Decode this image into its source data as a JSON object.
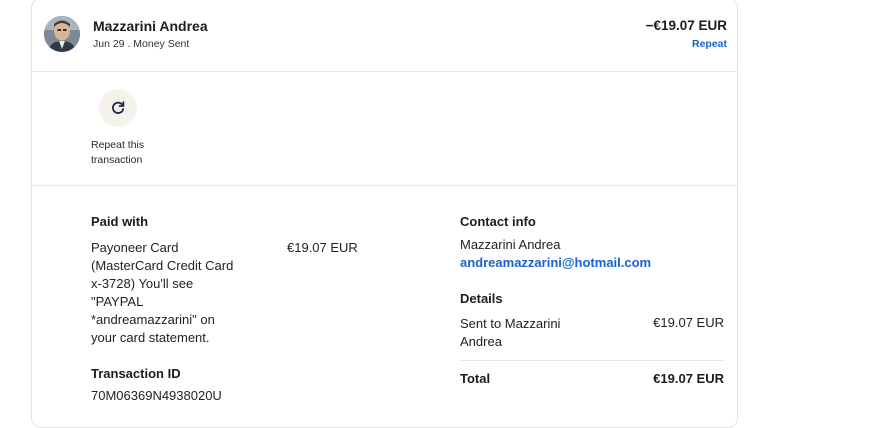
{
  "header": {
    "name": "Mazzarini Andrea",
    "subline": "Jun 29 . Money Sent",
    "amount": "−€19.07 EUR",
    "repeat_link": "Repeat"
  },
  "repeat_action": {
    "icon": "refresh-icon",
    "label": "Repeat this transaction"
  },
  "paid_with": {
    "heading": "Paid with",
    "description": "Payoneer Card (MasterCard Credit Card x-3728) You'll see \"PAYPAL *andreamazzarini\" on your card statement.",
    "amount": "€19.07 EUR"
  },
  "transaction": {
    "heading": "Transaction ID",
    "id": "70M06369N4938020U"
  },
  "contact": {
    "heading": "Contact info",
    "name": "Mazzarini Andrea",
    "email": "andreamazzarini@hotmail.com"
  },
  "details": {
    "heading": "Details",
    "item_label": "Sent to Mazzarini Andrea",
    "item_amount": "€19.07 EUR",
    "total_label": "Total",
    "total_amount": "€19.07 EUR"
  },
  "colors": {
    "link": "#1a63c8",
    "repeat_circle": "#f5f2ec",
    "border": "#e3e3e3"
  }
}
